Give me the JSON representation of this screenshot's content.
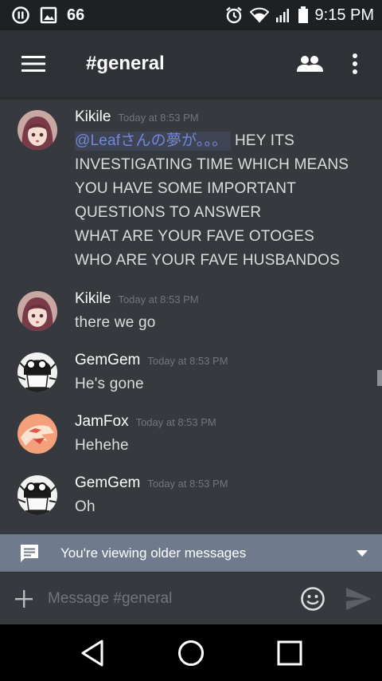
{
  "status_bar": {
    "notification_count": "66",
    "time": "9:15 PM",
    "icons": [
      "pause-circle-icon",
      "image-icon",
      "alarm-icon",
      "wifi-icon",
      "signal-icon",
      "battery-icon"
    ]
  },
  "header": {
    "channel_name": "#general",
    "icons": [
      "hamburger-menu-icon",
      "members-icon",
      "more-vertical-icon"
    ]
  },
  "messages": [
    {
      "author": "Kikile",
      "timestamp": "Today at 8:53 PM",
      "mention": "@Leafさんの夢が。。。",
      "lines": [
        "HEY ITS",
        "INVESTIGATING TIME WHICH MEANS",
        "YOU HAVE SOME IMPORTANT",
        "QUESTIONS TO ANSWER",
        "WHAT ARE YOUR FAVE OTOGES",
        "WHO ARE YOUR FAVE HUSBANDOS"
      ]
    },
    {
      "author": "Kikile",
      "timestamp": "Today at 8:53 PM",
      "text": "there we go"
    },
    {
      "author": "GemGem",
      "timestamp": "Today at 8:53 PM",
      "text": "He's gone"
    },
    {
      "author": "JamFox",
      "timestamp": "Today at 8:53 PM",
      "text": "Hehehe"
    },
    {
      "author": "GemGem",
      "timestamp": "Today at 8:53 PM",
      "text": "Oh"
    }
  ],
  "older_bar": {
    "text": "You're viewing older messages"
  },
  "composer": {
    "placeholder": "Message #general",
    "value": ""
  },
  "nav_bar": {
    "icons": [
      "back-icon",
      "home-icon",
      "recents-icon"
    ]
  },
  "colors": {
    "background": "#36393e",
    "header": "#2e3136",
    "status_bar": "#1e2124",
    "mention": "#7289da",
    "older_bar": "#6f7b8c"
  }
}
